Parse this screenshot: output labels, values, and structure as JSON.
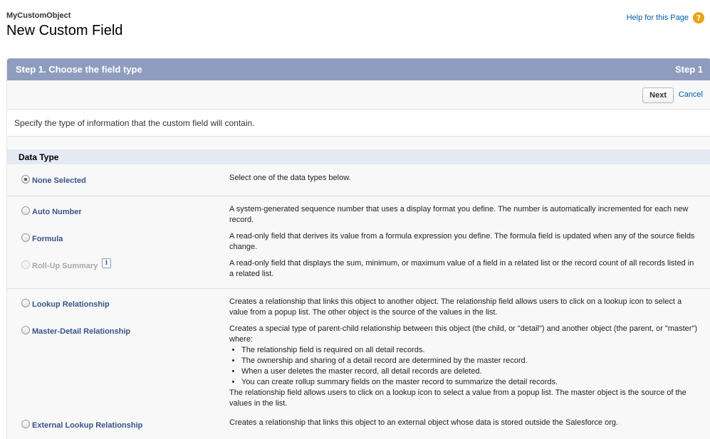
{
  "header": {
    "object_name": "MyCustomObject",
    "title": "New Custom Field",
    "help_label": "Help for this Page",
    "help_icon": "question-icon"
  },
  "step": {
    "title": "Step 1. Choose the field type",
    "number": "Step 1"
  },
  "buttons": {
    "next": "Next",
    "cancel": "Cancel"
  },
  "intro": "Specify the type of information that the custom field will contain.",
  "section_title": "Data Type",
  "types": [
    {
      "label": "None Selected",
      "selected": true,
      "desc": "Select one of the data types below."
    },
    {
      "label": "Auto Number",
      "desc": "A system-generated sequence number that uses a display format you define. The number is automatically incremented for each new record."
    },
    {
      "label": "Formula",
      "desc": "A read-only field that derives its value from a formula expression you define. The formula field is updated when any of the source fields change."
    },
    {
      "label": "Roll-Up Summary",
      "disabled": true,
      "info_icon": "i",
      "desc": "A read-only field that displays the sum, minimum, or maximum value of a field in a related list or the record count of all records listed in a related list."
    },
    {
      "label": "Lookup Relationship",
      "desc": "Creates a relationship that links this object to another object. The relationship field allows users to click on a lookup icon to select a value from a popup list. The other object is the source of the values in the list."
    },
    {
      "label": "Master-Detail Relationship",
      "desc": "Creates a special type of parent-child relationship between this object (the child, or \"detail\") and another object (the parent, or \"master\") where:",
      "bullets": [
        "The relationship field is required on all detail records.",
        "The ownership and sharing of a detail record are determined by the master record.",
        "When a user deletes the master record, all detail records are deleted.",
        "You can create rollup summary fields on the master record to summarize the detail records."
      ],
      "desc_after": "The relationship field allows users to click on a lookup icon to select a value from a popup list. The master object is the source of the values in the list."
    },
    {
      "label": "External Lookup Relationship",
      "desc": "Creates a relationship that links this object to an external object whose data is stored outside the Salesforce org."
    }
  ]
}
